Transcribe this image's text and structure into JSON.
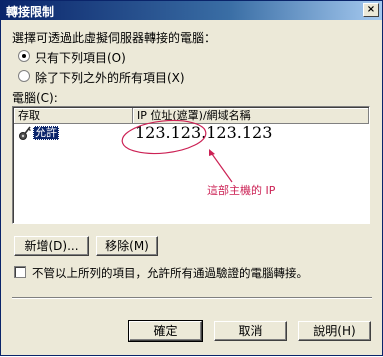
{
  "window": {
    "title": "轉接限制",
    "close_label": "×"
  },
  "prompt": "選擇可透過此虛擬伺服器轉接的電腦：",
  "radios": [
    {
      "label": "只有下列項目(O)",
      "selected": true
    },
    {
      "label": "除了下列之外的所有項目(X)",
      "selected": false
    }
  ],
  "list": {
    "label": "電腦(C):",
    "columns": [
      "存取",
      "IP 位址(遮罩)/網域名稱"
    ],
    "rows": [
      {
        "access": "允許",
        "address": "123.123.123.123"
      }
    ]
  },
  "annotation": {
    "label": "這部主機的 IP",
    "color": "#cc2255"
  },
  "buttons": {
    "add": "新增(D)...",
    "remove": "移除(M)",
    "ok": "確定",
    "cancel": "取消",
    "help": "說明(H)"
  },
  "checkbox": {
    "label": "不管以上所列的項目，允許所有通過驗證的電腦轉接。",
    "checked": false
  }
}
